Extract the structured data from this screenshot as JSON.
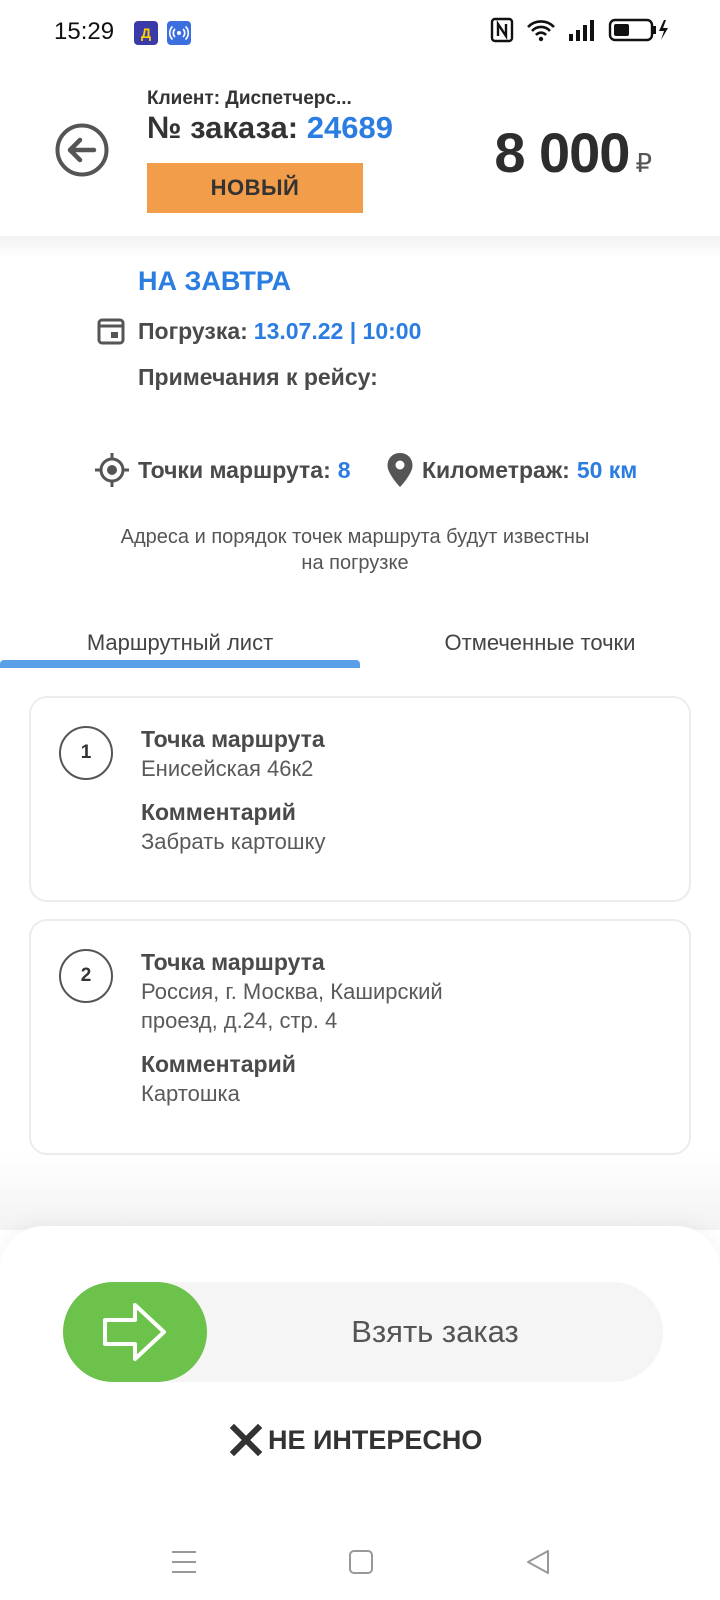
{
  "status_bar": {
    "time": "15:29",
    "app_badge_1": "Д"
  },
  "header": {
    "client": "Клиент: Диспетчерс...",
    "order_label": "№ заказа:",
    "order_number": "24689",
    "status": "НОВЫЙ",
    "price": "8 000",
    "currency": "₽"
  },
  "trip": {
    "when": "НА ЗАВТРА",
    "loading_label": "Погрузка:",
    "loading_value": "13.07.22 | 10:00",
    "notes_label": "Примечания к рейсу:",
    "points_label": "Точки маршрута:",
    "points_value": "8",
    "mileage_label": "Километраж:",
    "mileage_value": "50 км",
    "route_note": "Адреса и порядок точек маршрута будут известны на погрузке"
  },
  "tabs": [
    {
      "label": "Маршрутный лист",
      "active": true
    },
    {
      "label": "Отмеченные точки",
      "active": false
    }
  ],
  "route_points": [
    {
      "number": "1",
      "point_label": "Точка маршрута",
      "address": "Енисейская 46к2",
      "comment_label": "Комментарий",
      "comment": "Забрать картошку"
    },
    {
      "number": "2",
      "point_label": "Точка маршрута",
      "address": "Россия, г. Москва, Каширский проезд, д.24, стр. 4",
      "comment_label": "Комментарий",
      "comment": "Картошка"
    }
  ],
  "actions": {
    "take_order": "Взять заказ",
    "not_interested": "НЕ ИНТЕРЕСНО"
  },
  "colors": {
    "accent_blue": "#2b7de1",
    "status_orange": "#f29d4a",
    "slider_green": "#6cc24a"
  }
}
